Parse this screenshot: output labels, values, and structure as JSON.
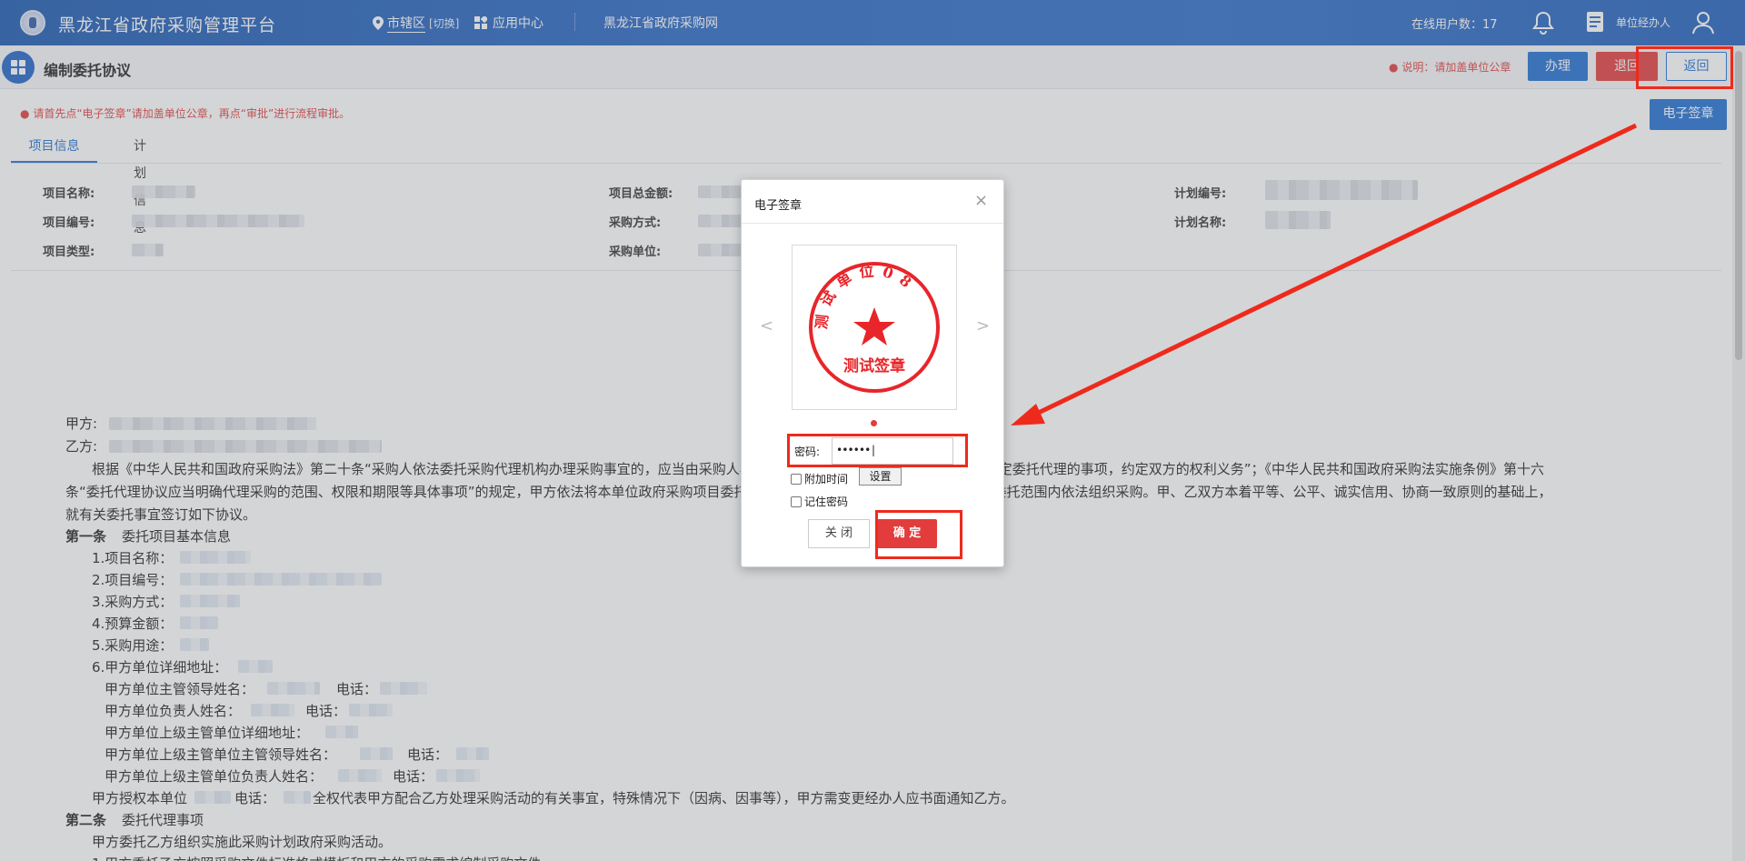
{
  "topbar": {
    "app_title": "黑龙江省政府采购管理平台",
    "region_label": "市辖区",
    "region_switch": "[切换]",
    "app_center": "应用中心",
    "portal_link": "黑龙江省政府采购网",
    "online_users": "在线用户数：17",
    "user_name": "单位经办人"
  },
  "header": {
    "page_title": "编制委托协议",
    "note": "说明：请加盖单位公章",
    "handle_button": "办理",
    "return_back_button": "退回",
    "back_button": "返回"
  },
  "warning": "请首先点“电子签章”请加盖单位公章，再点“审批”进行流程审批。",
  "esign_button": "电子签章",
  "tabs": [
    "项目信息",
    "计划信息"
  ],
  "project_info": {
    "col1": [
      "项目名称:",
      "项目编号:",
      "项目类型:"
    ],
    "col2": [
      "项目总金额:",
      "采购方式:",
      "采购单位:"
    ],
    "col3": [
      "计划编号:",
      "计划名称:"
    ]
  },
  "document": {
    "party_a": "甲方:",
    "party_b": "乙方:",
    "para1_l1": "根据《中华人民共和国政府采购法》第二十条“采购人依法委托采购代理机构办理采购事宜的，应当由采购人与采购代理机构签订委托代理协议，依法确定委托代理的事项，约定双方的权利义务”；《中华人民共和国政府采购法实施条例》第十六",
    "para1_l2": "条“委托代理协议应当明确代理采购的范围、权限和期限等具体事项”的规定，甲方依法将本单位政府采购项目委托乙方代理，乙方依法接受甲方委托，在受委托范围内依法组织采购。甲、乙双方本着平等、公平、诚实信用、协商一致原则的基础上，",
    "para1_l3": "就有关委托事宜签订如下协议。",
    "article1": "第一条",
    "article1_title": "委托项目基本信息",
    "items": [
      "1.项目名称：",
      "2.项目编号：",
      "3.采购方式：",
      "4.预算金额：",
      "5.采购用途：",
      "6.甲方单位详细地址："
    ],
    "sub_items": [
      "甲方单位主管领导姓名：",
      "甲方单位负责人姓名：",
      "甲方单位上级主管单位详细地址：",
      "甲方单位上级主管单位主管领导姓名：",
      "甲方单位上级主管单位负责人姓名："
    ],
    "phone": "电话：",
    "auth_prefix": "甲方授权本单位",
    "auth_phone": "电话：",
    "auth_text": "全权代表甲方配合乙方处理采购活动的有关事宜，特殊情况下（因病、因事等），甲方需变更经办人应书面通知乙方。",
    "article2": "第二条",
    "article2_title": "委托代理事项",
    "article2_l1": "甲方委托乙方组织实施此采购计划政府采购活动。",
    "article2_l2": "1.甲方委托乙方按照采购文件标准格式模板和甲方的采购需求编制采购文件。"
  },
  "dialog": {
    "title": "电子签章",
    "close_symbol": "×",
    "seal_top_text": "测试单位08",
    "seal_bottom_text": "测试签章",
    "prev_symbol": "<",
    "next_symbol": ">",
    "password_label": "密码:",
    "password_value": "••••••|",
    "add_time_label": "附加时间",
    "settings_button": "设置",
    "remember_label": "记住密码",
    "close_button": "关 闭",
    "ok_button": "确 定"
  },
  "colors": {
    "primary": "#1f6fd1",
    "danger": "#e23c3c",
    "annotation": "#ee2a1c"
  }
}
